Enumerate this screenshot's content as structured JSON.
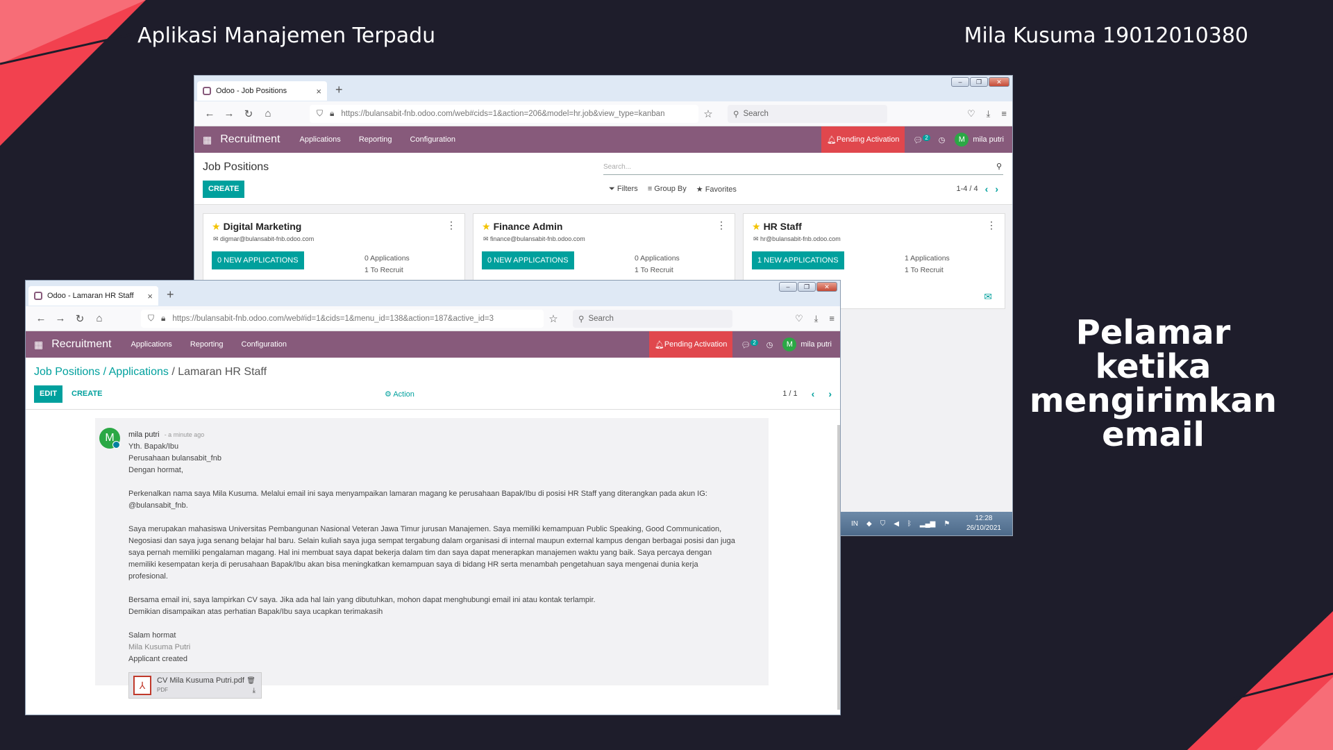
{
  "slide": {
    "title": "Aplikasi Manajemen Terpadu",
    "author": "Mila Kusuma 19012010380",
    "caption": "Pelamar ketika mengirimkan email"
  },
  "back_window": {
    "tab_title": "Odoo - Job Positions",
    "url": "https://bulansabit-fnb.odoo.com/web#cids=1&action=206&model=hr.job&view_type=kanban",
    "search_placeholder": "Search",
    "app_name": "Recruitment",
    "menus": [
      "Applications",
      "Reporting",
      "Configuration"
    ],
    "pending": "Pending Activation",
    "chat_count": "2",
    "user": "mila putri",
    "user_initial": "M",
    "breadcrumb": "Job Positions",
    "create_label": "CREATE",
    "search_hint": "Search...",
    "filters": "Filters",
    "group_by": "Group By",
    "favorites": "Favorites",
    "pager": "1-4 / 4",
    "cards": [
      {
        "name": "Digital Marketing",
        "email": "digmar@bulansabit-fnb.odoo.com",
        "button": "0 NEW APPLICATIONS",
        "applications": "0 Applications",
        "to_recruit": "1 To Recruit"
      },
      {
        "name": "Finance Admin",
        "email": "finance@bulansabit-fnb.odoo.com",
        "button": "0 NEW APPLICATIONS",
        "applications": "0 Applications",
        "to_recruit": "1 To Recruit"
      },
      {
        "name": "HR Staff",
        "email": "hr@bulansabit-fnb.odoo.com",
        "button": "1 NEW APPLICATIONS",
        "applications": "1 Applications",
        "to_recruit": "1 To Recruit"
      }
    ],
    "taskbar": {
      "lang": "IN",
      "time": "12:28",
      "date": "26/10/2021"
    }
  },
  "front_window": {
    "tab_title": "Odoo - Lamaran HR Staff",
    "url": "https://bulansabit-fnb.odoo.com/web#id=1&cids=1&menu_id=138&action=187&active_id=3",
    "search_placeholder": "Search",
    "app_name": "Recruitment",
    "menus": [
      "Applications",
      "Reporting",
      "Configuration"
    ],
    "pending": "Pending Activation",
    "chat_count": "2",
    "user": "mila putri",
    "user_initial": "M",
    "breadcrumb": {
      "part1": "Job Positions",
      "sep1": " / ",
      "part2": "Applications",
      "sep2": " / ",
      "current": "Lamaran HR Staff"
    },
    "edit_label": "EDIT",
    "create_label": "CREATE",
    "action_label": "Action",
    "pager": "1 / 1",
    "message": {
      "author": "mila putri",
      "time": "- a minute ago",
      "initial": "M",
      "greeting": [
        "Yth. Bapak/Ibu",
        "Perusahaan bulansabit_fnb",
        "Dengan hormat,"
      ],
      "para1": "Perkenalkan nama saya Mila Kusuma. Melalui email ini saya menyampaikan lamaran magang ke perusahaan Bapak/Ibu di posisi  HR Staff yang diterangkan pada akun IG: @bulansabit_fnb.",
      "para2": "Saya merupakan mahasiswa Universitas Pembangunan Nasional Veteran Jawa Timur jurusan Manajemen. Saya memiliki kemampuan Public Speaking, Good Communication, Negosiasi dan saya juga senang belajar hal baru. Selain kuliah saya juga sempat tergabung dalam organisasi di internal maupun external kampus  dengan berbagai posisi dan juga saya pernah memiliki pengalaman magang. Hal ini membuat saya dapat bekerja dalam tim dan saya dapat  menerapkan manajemen waktu yang baik. Saya percaya dengan memiliki kesempatan kerja di perusahaan Bapak/Ibu akan bisa meningkatkan kemampuan saya di bidang  HR serta menambah pengetahuan saya mengenai dunia kerja profesional.",
      "para3_l1": "Bersama email ini, saya lampirkan CV saya. Jika ada hal lain yang dibutuhkan, mohon dapat menghubungi email ini atau kontak terlampir.",
      "para3_l2": "Demikian disampaikan atas perhatian Bapak/Ibu saya ucapkan terimakasih",
      "closing": "Salam hormat",
      "signature": "Mila Kusuma Putri",
      "note": "Applicant created",
      "attachment": {
        "name": "CV Mila Kusuma Putri.pdf",
        "type": "PDF"
      }
    }
  },
  "colors": {
    "odoo": "#875a7b",
    "teal": "#00a09d",
    "pending": "#e0474d",
    "bg": "#1e1d2b",
    "accent": "#f2414f"
  }
}
